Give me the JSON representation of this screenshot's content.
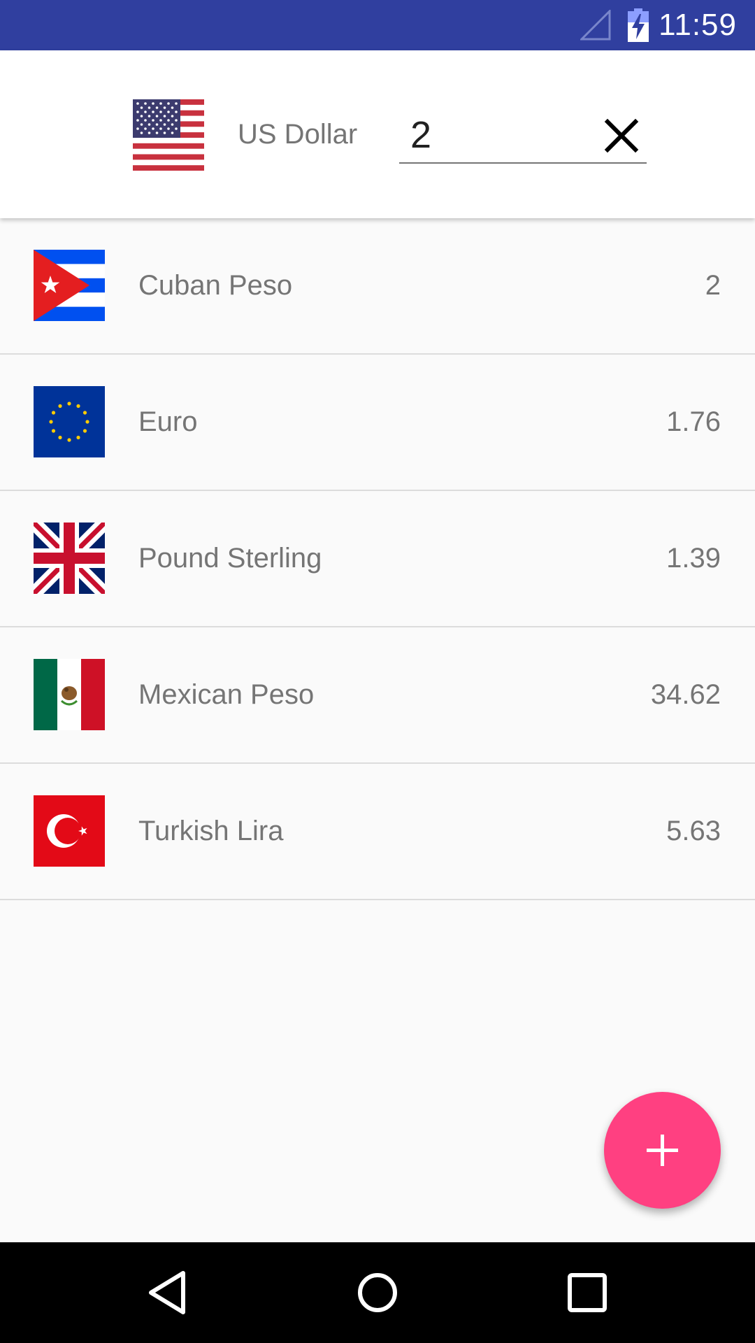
{
  "status_bar": {
    "time": "11:59",
    "icons": [
      "signal-icon",
      "battery-charging-icon"
    ]
  },
  "base_currency": {
    "flag": "us-flag-icon",
    "name": "US Dollar",
    "amount": "2",
    "clear_icon": "close-icon"
  },
  "currencies": [
    {
      "flag": "cuba-flag-icon",
      "name": "Cuban Peso",
      "value": "2"
    },
    {
      "flag": "eu-flag-icon",
      "name": "Euro",
      "value": "1.76"
    },
    {
      "flag": "uk-flag-icon",
      "name": "Pound Sterling",
      "value": "1.39"
    },
    {
      "flag": "mexico-flag-icon",
      "name": "Mexican Peso",
      "value": "34.62"
    },
    {
      "flag": "turkey-flag-icon",
      "name": "Turkish Lira",
      "value": "5.63"
    }
  ],
  "fab": {
    "icon": "plus-icon"
  },
  "navigation": {
    "buttons": [
      "back-icon",
      "home-icon",
      "recents-icon"
    ]
  },
  "colors": {
    "status_bar": "#303f9f",
    "accent": "#ff4081",
    "background": "#fafafa",
    "text_secondary": "#757575"
  }
}
